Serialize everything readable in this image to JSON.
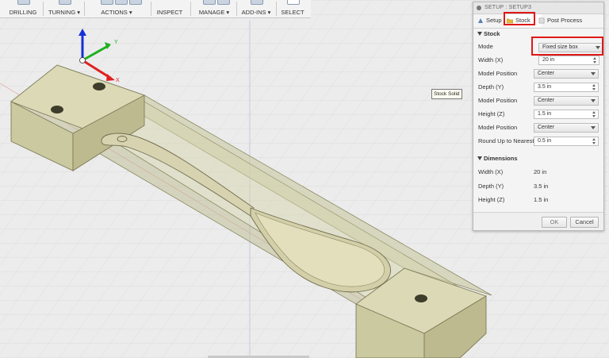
{
  "toolbar": {
    "groups": [
      {
        "label": "DRILLING"
      },
      {
        "label": "TURNING ▾"
      },
      {
        "label": "ACTIONS ▾"
      },
      {
        "label": "INSPECT"
      },
      {
        "label": "MANAGE ▾"
      },
      {
        "label": "ADD-INS ▾"
      },
      {
        "label": "SELECT"
      }
    ]
  },
  "viewport": {
    "tooltip": "Stock Solid",
    "axes": {
      "y_label": "Y",
      "x_label": "X"
    },
    "colors": {
      "stock": "#c9c79a",
      "axis_x": "#e02020",
      "axis_y": "#20b020",
      "axis_z": "#1530d8"
    }
  },
  "panel": {
    "title": "SETUP : SETUP3",
    "tabs": {
      "setup": "Setup",
      "stock": "Stock",
      "post": "Post Process"
    },
    "stock_section": "Stock",
    "rows": {
      "mode": {
        "label": "Mode",
        "value": "Fixed size box"
      },
      "width": {
        "label": "Width (X)",
        "value": "20 in"
      },
      "pos1": {
        "label": "Model Position",
        "value": "Center"
      },
      "depth": {
        "label": "Depth (Y)",
        "value": "3.5 in"
      },
      "pos2": {
        "label": "Model Position",
        "value": "Center"
      },
      "height": {
        "label": "Height (Z)",
        "value": "1.5 in"
      },
      "pos3": {
        "label": "Model Position",
        "value": "Center"
      },
      "round": {
        "label": "Round Up to Nearest",
        "value": "0.5 in"
      }
    },
    "dimensions_section": "Dimensions",
    "dims": {
      "width": {
        "label": "Width (X)",
        "value": "20 in"
      },
      "depth": {
        "label": "Depth (Y)",
        "value": "3.5 in"
      },
      "height": {
        "label": "Height (Z)",
        "value": "1.5 in"
      }
    },
    "ok_label": "OK",
    "cancel_label": "Cancel",
    "highlight_color": "#e01818"
  }
}
